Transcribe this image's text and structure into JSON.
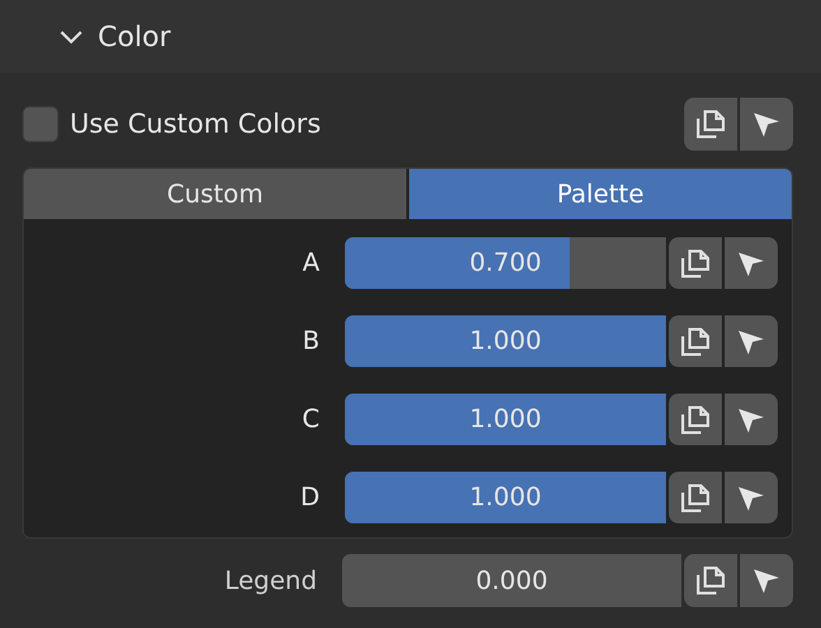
{
  "panel": {
    "title": "Color",
    "expanded": true
  },
  "use_custom_colors": {
    "label": "Use Custom Colors",
    "checked": false
  },
  "tabs": [
    {
      "label": "Custom",
      "selected": false
    },
    {
      "label": "Palette",
      "selected": true
    }
  ],
  "sliders": [
    {
      "label": "A",
      "value": "0.700",
      "level": 0.7
    },
    {
      "label": "B",
      "value": "1.000",
      "level": 1
    },
    {
      "label": "C",
      "value": "1.000",
      "level": 1
    },
    {
      "label": "D",
      "value": "1.000",
      "level": 1
    }
  ],
  "legend": {
    "label": "Legend",
    "value": "0.000"
  }
}
